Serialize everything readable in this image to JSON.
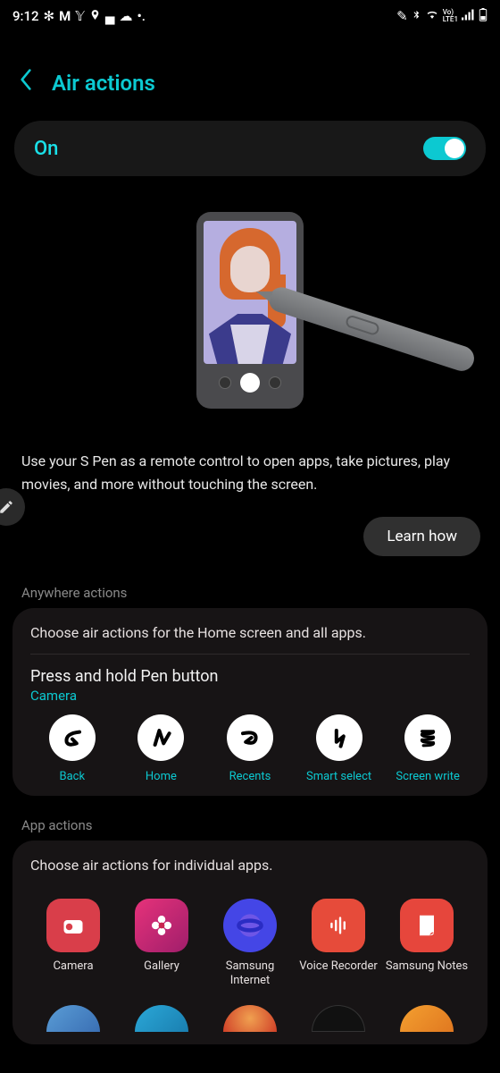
{
  "status": {
    "time": "9:12",
    "left_icons": [
      "fan-icon",
      "mail-m-icon",
      "twitter-bird-icon",
      "location-pin-icon",
      "cloud-icon",
      "cloud-fill-icon",
      "dots-icon"
    ],
    "right_icons": [
      "pen-edit-icon",
      "bluetooth-icon",
      "wifi-icon",
      "volte-icon",
      "signal-bars-icon",
      "battery-icon"
    ],
    "lte_label": "LTE1",
    "vo_label": "Vo)"
  },
  "header": {
    "title": "Air actions"
  },
  "master_toggle": {
    "label": "On",
    "enabled": true
  },
  "description": "Use your S Pen as a remote control to open apps, take pictures, play movies, and more without touching the screen.",
  "learn_how_label": "Learn how",
  "anywhere": {
    "section_label": "Anywhere actions",
    "intro": "Choose air actions for the Home screen and all apps.",
    "press_hold_title": "Press and hold Pen button",
    "press_hold_app": "Camera",
    "gestures": [
      {
        "name": "back-gesture",
        "label": "Back"
      },
      {
        "name": "home-gesture",
        "label": "Home"
      },
      {
        "name": "recents-gesture",
        "label": "Recents"
      },
      {
        "name": "smart-select-gesture",
        "label": "Smart select"
      },
      {
        "name": "screen-write-gesture",
        "label": "Screen write"
      }
    ]
  },
  "app_actions": {
    "section_label": "App actions",
    "intro": "Choose air actions for individual apps.",
    "apps": [
      {
        "name": "camera-app",
        "label": "Camera",
        "bg": "#d93e4a"
      },
      {
        "name": "gallery-app",
        "label": "Gallery",
        "bg": "#c9254f"
      },
      {
        "name": "samsung-internet-app",
        "label": "Samsung Internet",
        "bg": "#4446e6"
      },
      {
        "name": "voice-recorder-app",
        "label": "Voice Recorder",
        "bg": "#e64b3a"
      },
      {
        "name": "samsung-notes-app",
        "label": "Samsung Notes",
        "bg": "#e6463c"
      }
    ]
  }
}
